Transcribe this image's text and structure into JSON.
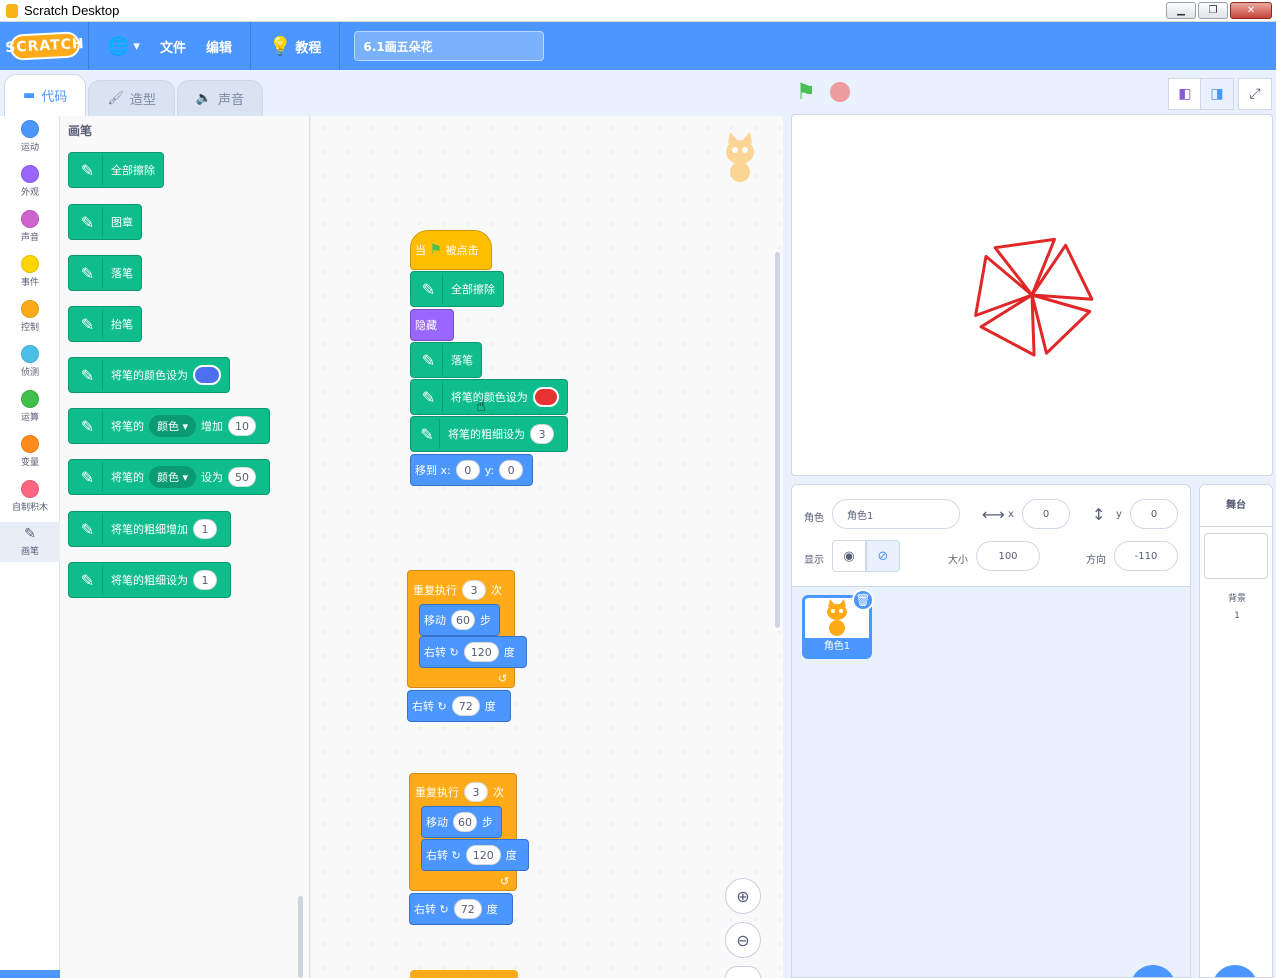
{
  "window": {
    "title": "Scratch Desktop"
  },
  "menubar": {
    "logo": "SCRATCH",
    "file": "文件",
    "edit": "编辑",
    "tutorials": "教程",
    "project_title": "6.1画五朵花"
  },
  "tabs": {
    "code": "代码",
    "costumes": "造型",
    "sounds": "声音"
  },
  "categories": [
    {
      "label": "运动",
      "color": "#4c97ff"
    },
    {
      "label": "外观",
      "color": "#9966ff"
    },
    {
      "label": "声音",
      "color": "#cf63cf"
    },
    {
      "label": "事件",
      "color": "#ffd500"
    },
    {
      "label": "控制",
      "color": "#ffab19"
    },
    {
      "label": "侦测",
      "color": "#4cbfe6"
    },
    {
      "label": "运算",
      "color": "#40bf4a"
    },
    {
      "label": "变量",
      "color": "#ff8c1a"
    },
    {
      "label": "自制积木",
      "color": "#ff6680"
    },
    {
      "label": "画笔",
      "color": "#0fbd8c"
    }
  ],
  "palette": {
    "title": "画笔",
    "blocks": {
      "clear": "全部擦除",
      "stamp": "图章",
      "pen_down": "落笔",
      "pen_up": "抬笔",
      "set_color": "将笔的颜色设为",
      "change_prefix": "将笔的",
      "color_dd": "颜色",
      "change_by": "增加",
      "change_value": "10",
      "set_prefix": "将笔的",
      "set_to": "设为",
      "set_value": "50",
      "change_size": "将笔的粗细增加",
      "change_size_value": "1",
      "set_size": "将笔的粗细设为",
      "set_size_value": "1"
    },
    "swatch_color": "#4c6ff0"
  },
  "script1": {
    "when_pre": "当",
    "when_post": "被点击",
    "clear": "全部擦除",
    "hide": "隐藏",
    "pen_down": "落笔",
    "set_color": "将笔的颜色设为",
    "set_size": "将笔的粗细设为",
    "size_value": "3",
    "goto_x": "移到 x:",
    "x_value": "0",
    "goto_y": "y:",
    "y_value": "0",
    "color_value": "#e63232"
  },
  "script2": {
    "repeat": "重复执行",
    "repeat_value": "3",
    "times": "次",
    "move": "移动",
    "move_value": "60",
    "steps": "步",
    "turn": "右转",
    "turn_value": "120",
    "deg": "度",
    "turn2": "右转",
    "turn2_value": "72",
    "deg2": "度"
  },
  "script3": {
    "repeat": "重复执行",
    "repeat_value": "3",
    "times": "次",
    "move": "移动",
    "move_value": "60",
    "steps": "步",
    "turn": "右转",
    "turn_value": "120",
    "deg": "度",
    "turn2": "右转",
    "turn2_value": "72",
    "deg2": "度"
  },
  "sprite_info": {
    "sprite_label": "角色",
    "sprite_name": "角色1",
    "x_label": "x",
    "x_value": "0",
    "y_label": "y",
    "y_value": "0",
    "show_label": "显示",
    "size_label": "大小",
    "size_value": "100",
    "direction_label": "方向",
    "direction_value": "-110"
  },
  "sprite_list": {
    "sprite1": "角色1"
  },
  "stage_pane": {
    "header": "舞台",
    "backdrops_label": "背景",
    "backdrops_count": "1"
  },
  "stage": {
    "drawing_color": "#e02828"
  }
}
